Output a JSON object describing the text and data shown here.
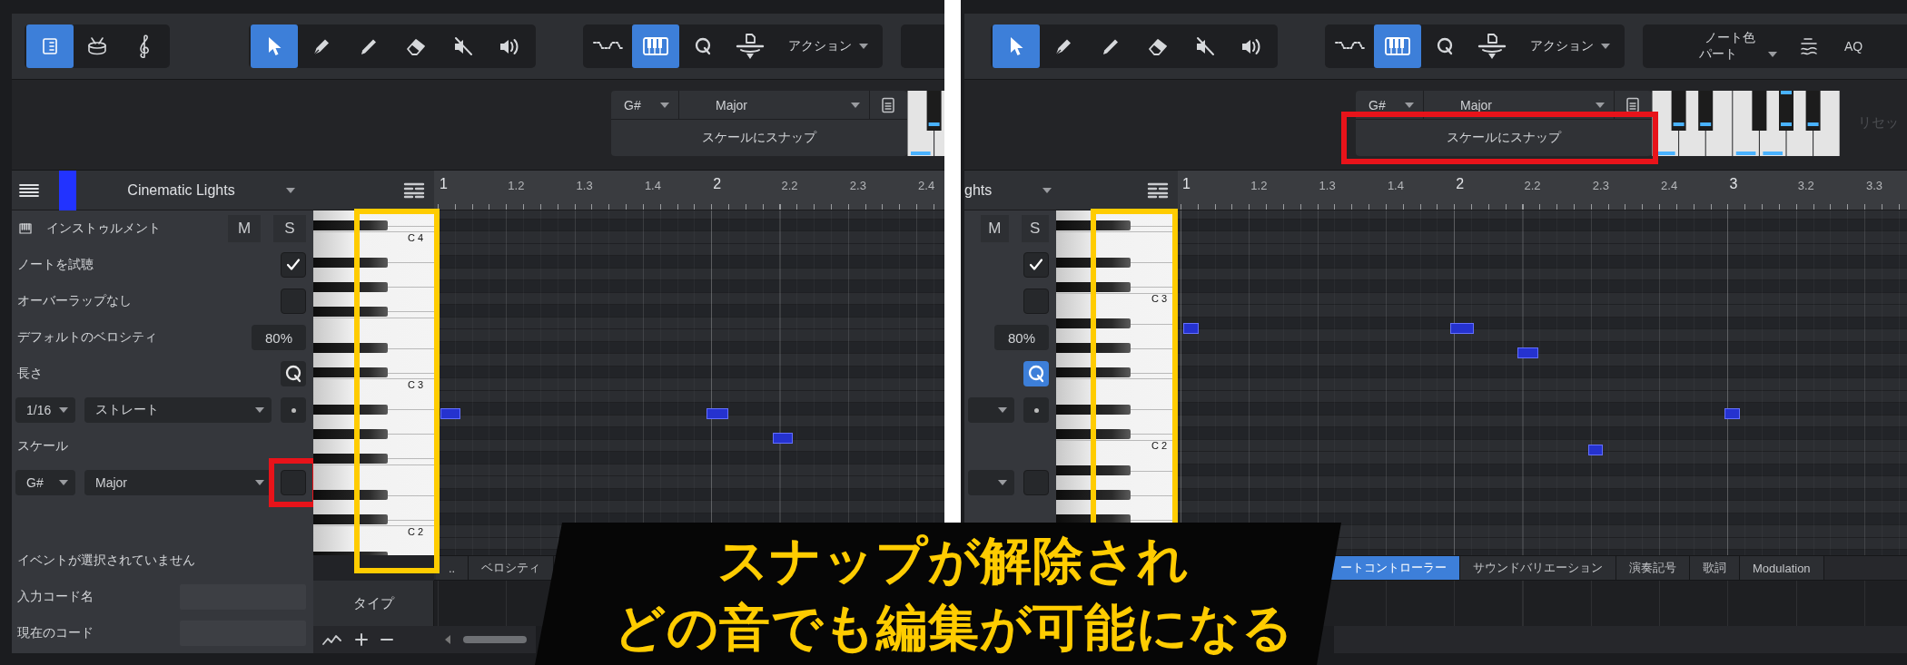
{
  "panels": [
    {
      "kind": "full",
      "toolbar": {
        "view_buttons": [
          {
            "selected": true
          },
          {
            "selected": false
          },
          {
            "selected": false
          }
        ],
        "tool_buttons": [
          {
            "selected": true
          },
          {
            "selected": false
          },
          {
            "selected": false
          },
          {
            "selected": false
          },
          {
            "selected": false
          },
          {
            "selected": false
          }
        ],
        "edit_buttons": [
          {
            "selected": false
          },
          {
            "selected": true
          },
          {
            "selected": false
          },
          {
            "selected": false
          }
        ],
        "action_menu": "アクション"
      },
      "scale_bar": {
        "key": "G#",
        "scale": "Major",
        "snap_label": "スケールにスナップ",
        "highlighted": false
      },
      "track": {
        "name": "Cinematic Lights",
        "color": "#2233ff"
      },
      "inspector": [
        {
          "kind": "instrument",
          "label": "インストゥルメント",
          "mute_label": "M",
          "solo_label": "S"
        },
        {
          "kind": "check",
          "label": "ノートを試聴",
          "checked": true
        },
        {
          "kind": "check",
          "label": "オーバーラップなし",
          "checked": false
        },
        {
          "kind": "value",
          "label": "デフォルトのベロシティ",
          "value": "80%"
        },
        {
          "kind": "quantize",
          "label": "長さ",
          "selected": false
        },
        {
          "kind": "length",
          "length": "1/16",
          "mode": "ストレート"
        },
        {
          "kind": "heading",
          "label": "スケール"
        },
        {
          "kind": "scale",
          "key": "G#",
          "scale": "Major",
          "checked": false,
          "highlighted": true
        },
        {
          "kind": "status",
          "label": "イベントが選択されていません"
        },
        {
          "kind": "field",
          "label": "入力コード名"
        },
        {
          "kind": "field",
          "label": "現在のコード"
        }
      ],
      "ruler": [
        "1",
        "1.2",
        "1.3",
        "1.4",
        "2",
        "2.2",
        "2.3",
        "2.4"
      ],
      "key_labels": [
        "C 4",
        "C 3",
        "C 2"
      ],
      "keys_highlighted": true,
      "tabs": [
        {
          "label": "..",
          "selected": false
        },
        {
          "label": "ベロシティ",
          "selected": false
        }
      ],
      "lane_button": "タイプ"
    },
    {
      "kind": "cropped",
      "toolbar": {
        "tool_buttons": [
          {
            "selected": true
          },
          {
            "selected": false
          },
          {
            "selected": false
          },
          {
            "selected": false
          },
          {
            "selected": false
          },
          {
            "selected": false
          }
        ],
        "edit_buttons": [
          {
            "selected": false
          },
          {
            "selected": true
          },
          {
            "selected": false
          },
          {
            "selected": false
          }
        ],
        "action_menu": "アクション",
        "note_color": {
          "label": "ノート色",
          "value": "パート"
        },
        "aq_label": "AQ"
      },
      "scale_bar": {
        "key": "G#",
        "scale": "Major",
        "snap_label": "スケールにスナップ",
        "highlighted": true,
        "reset_label": "リセッ"
      },
      "track": {
        "name": "ghts"
      },
      "inspector": [
        {
          "kind": "instrument",
          "mute_label": "M",
          "solo_label": "S"
        },
        {
          "kind": "check",
          "checked": true
        },
        {
          "kind": "check",
          "checked": false
        },
        {
          "kind": "value",
          "value": "80%"
        },
        {
          "kind": "quantize",
          "selected": true
        },
        {
          "kind": "length"
        },
        {
          "kind": "heading"
        },
        {
          "kind": "scale",
          "checked": false,
          "highlighted": false
        }
      ],
      "ruler": [
        "1",
        "1.2",
        "1.3",
        "1.4",
        "2",
        "2.2",
        "2.3",
        "2.4",
        "3",
        "3.2",
        "3.3"
      ],
      "key_labels": [
        "C 3",
        "C 2"
      ],
      "keys_highlighted": true,
      "tabs": [
        {
          "label": "ートコントローラー",
          "selected": true
        },
        {
          "label": "サウンドバリエーション",
          "selected": false
        },
        {
          "label": "演奏記号",
          "selected": false
        },
        {
          "label": "歌詞",
          "selected": false
        },
        {
          "label": "Modulation",
          "selected": false
        }
      ]
    }
  ],
  "caption": {
    "lines": [
      "スナップが解除され",
      "どの音でも編集が可能になる"
    ]
  }
}
